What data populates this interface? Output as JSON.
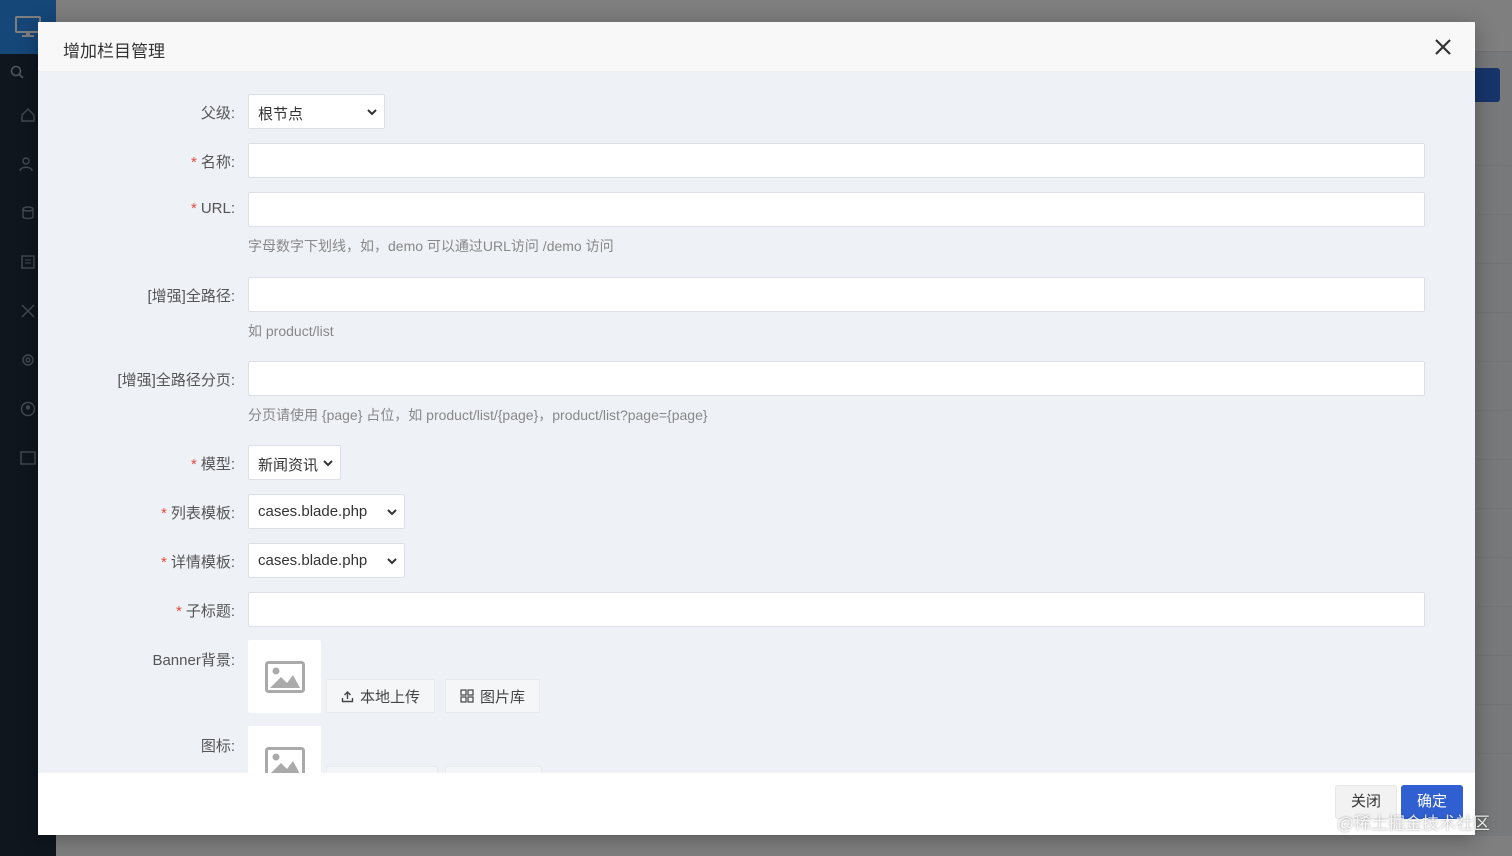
{
  "modal": {
    "title": "增加栏目管理"
  },
  "form": {
    "parent": {
      "label": "父级:",
      "value": "根节点"
    },
    "name": {
      "label": "名称:",
      "required": true,
      "value": ""
    },
    "url": {
      "label": "URL:",
      "required": true,
      "value": "",
      "hint": "字母数字下划线，如，demo 可以通过URL访问 /demo 访问"
    },
    "full_path": {
      "label": "[增强]全路径:",
      "value": "",
      "hint": "如 product/list"
    },
    "full_path_page": {
      "label": "[增强]全路径分页:",
      "value": "",
      "hint": "分页请使用 {page} 占位，如 product/list/{page}，product/list?page={page}"
    },
    "model": {
      "label": "模型:",
      "required": true,
      "value": "新闻资讯"
    },
    "list_template": {
      "label": "列表模板:",
      "required": true,
      "value": "cases.blade.php"
    },
    "detail_template": {
      "label": "详情模板:",
      "required": true,
      "value": "cases.blade.php"
    },
    "subtitle": {
      "label": "子标题:",
      "required": true,
      "value": ""
    },
    "banner": {
      "label": "Banner背景:",
      "upload_label": "本地上传",
      "gallery_label": "图片库"
    },
    "icon": {
      "label": "图标:"
    }
  },
  "footer": {
    "close_label": "关闭",
    "ok_label": "确定"
  },
  "watermark": "@稀土掘金技术社区",
  "colors": {
    "primary": "#2f5fd0",
    "required": "#e74c3c",
    "sidebar": "#1f2d3d"
  }
}
